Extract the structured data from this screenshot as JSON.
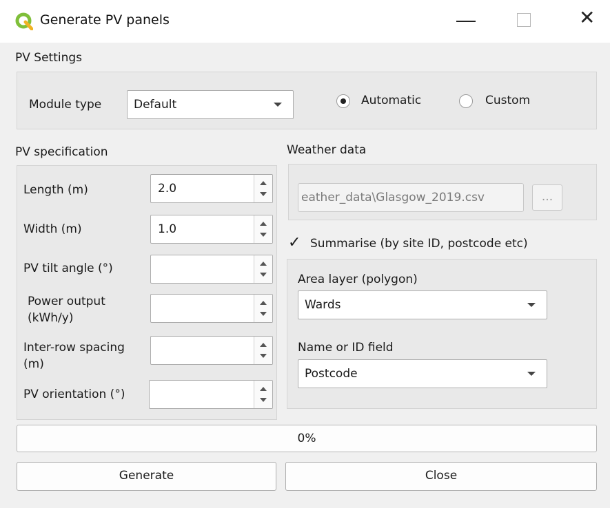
{
  "window": {
    "title": "Generate PV panels",
    "icon": "qgis-icon",
    "minimize_icon": "minimize-icon",
    "maximize_icon": "maximize-icon",
    "close_glyph": "✕"
  },
  "pv_settings": {
    "title": "PV Settings",
    "module_type_label": "Module type",
    "module_type_value": "Default",
    "radio_automatic": "Automatic",
    "radio_custom": "Custom",
    "selected": "Automatic"
  },
  "pv_specification": {
    "title": "PV specification",
    "length_label": "Length (m)",
    "length_value": "2.0",
    "width_label": "Width (m)",
    "width_value": "1.0",
    "tilt_label": "PV tilt angle (°)",
    "tilt_value": "",
    "power_label_1": "Power output",
    "power_label_2": "(kWh/y)",
    "power_value": "",
    "spacing_label_1": "Inter-row spacing",
    "spacing_label_2": "(m)",
    "spacing_value": "",
    "orientation_label": "PV orientation (°)",
    "orientation_value": ""
  },
  "weather": {
    "title": "Weather data",
    "file_value": "eather_data\\Glasgow_2019.csv",
    "browse_label": "..."
  },
  "summarise": {
    "checked": true,
    "check_glyph": "✓",
    "label": "Summarise (by site ID, postcode etc)",
    "area_layer_label": "Area layer (polygon)",
    "area_layer_value": "Wards",
    "name_field_label": "Name or ID field",
    "name_field_value": "Postcode"
  },
  "progress": {
    "value": 0,
    "text": "0%"
  },
  "buttons": {
    "generate": "Generate",
    "close": "Close"
  },
  "colors": {
    "qgis_green": "#7fbf3a",
    "qgis_yellow": "#f0b323",
    "dialog_bg": "#f0f0f0"
  }
}
